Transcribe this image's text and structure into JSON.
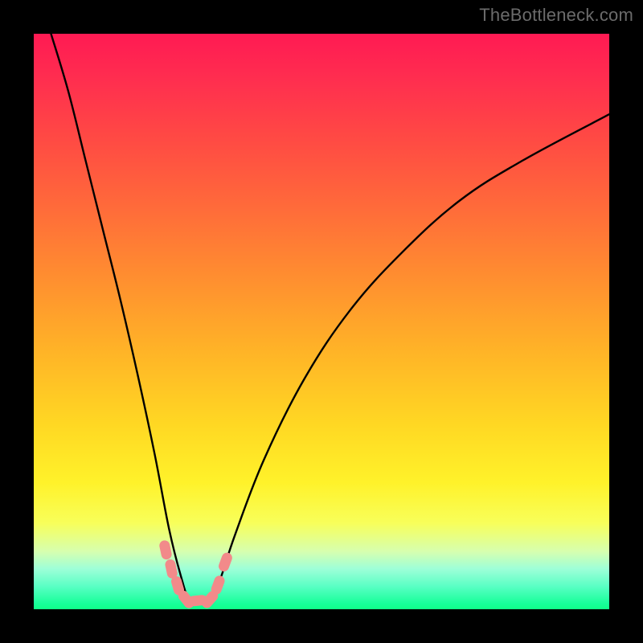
{
  "watermark": "TheBottleneck.com",
  "colors": {
    "frame": "#000000",
    "curve": "#000000",
    "marker_fill": "#f28a8a",
    "marker_stroke": "#ef9898"
  },
  "chart_data": {
    "type": "line",
    "title": "",
    "xlabel": "",
    "ylabel": "",
    "xlim": [
      0,
      100
    ],
    "ylim": [
      0,
      100
    ],
    "grid": false,
    "legend": false,
    "note": "Percent values estimated from vertical position within plot area; left branch falls from ~100% to ~0% at minimum near x≈27, right branch rises back toward ~90% at right edge.",
    "series": [
      {
        "name": "curve",
        "x": [
          3,
          6,
          9,
          12,
          15,
          18,
          21,
          23.5,
          25.5,
          27,
          29,
          31,
          32.5,
          35,
          40,
          47,
          55,
          64,
          74,
          85,
          100
        ],
        "y": [
          100,
          90,
          78,
          66,
          54,
          41,
          27,
          14,
          6,
          1.8,
          1.5,
          2.2,
          5.5,
          13,
          26,
          40,
          52,
          62,
          71,
          78,
          86
        ]
      }
    ],
    "markers": {
      "name": "flat-region-markers",
      "shape": "rounded-capsule",
      "points": [
        {
          "x": 22.9,
          "y": 10.3
        },
        {
          "x": 23.9,
          "y": 7.0
        },
        {
          "x": 25.0,
          "y": 4.1
        },
        {
          "x": 26.5,
          "y": 1.7
        },
        {
          "x": 28.5,
          "y": 1.5
        },
        {
          "x": 30.6,
          "y": 1.7
        },
        {
          "x": 32.0,
          "y": 4.2
        },
        {
          "x": 33.3,
          "y": 8.2
        }
      ]
    }
  }
}
